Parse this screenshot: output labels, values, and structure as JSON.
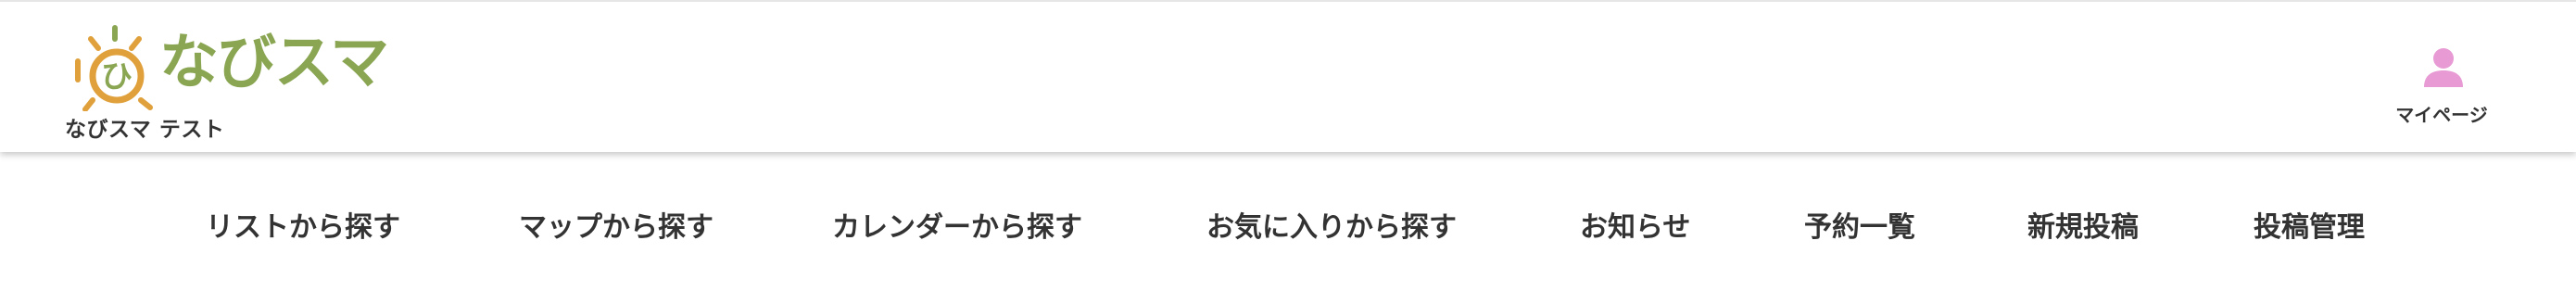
{
  "header": {
    "logo_text": "なびスマ",
    "site_name": "なびスマ テスト",
    "mypage_label": "マイページ",
    "mypage_icon": "user-icon"
  },
  "nav": {
    "items": [
      {
        "label": "リストから探す"
      },
      {
        "label": "マップから探す"
      },
      {
        "label": "カレンダーから探す"
      },
      {
        "label": "お気に入りから探す"
      },
      {
        "label": "お知らせ"
      },
      {
        "label": "予約一覧"
      },
      {
        "label": "新規投稿"
      },
      {
        "label": "投稿管理"
      }
    ]
  },
  "colors": {
    "logo_orange": "#e0a13c",
    "logo_green": "#8aa653",
    "icon_pink": "#e79ad3",
    "text_dark": "#333333"
  }
}
